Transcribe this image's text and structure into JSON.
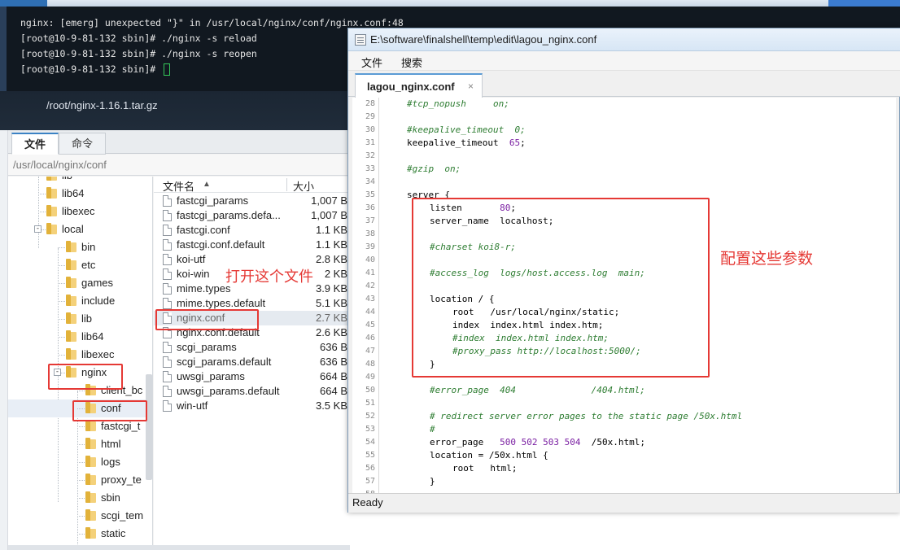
{
  "terminal": {
    "lines": [
      "nginx: [emerg] unexpected \"}\" in /usr/local/nginx/conf/nginx.conf:48",
      "[root@10-9-81-132 sbin]# ./nginx -s reload",
      "[root@10-9-81-132 sbin]# ./nginx -s reopen",
      "[root@10-9-81-132 sbin]# "
    ],
    "current_path": "/root/nginx-1.16.1.tar.gz"
  },
  "file_manager": {
    "tabs": [
      {
        "label": "文件",
        "active": true
      },
      {
        "label": "命令",
        "active": false
      }
    ],
    "path": "/usr/local/nginx/conf",
    "tree": [
      {
        "label": "lib",
        "selected": false
      },
      {
        "label": "lib64",
        "selected": false
      },
      {
        "label": "libexec",
        "selected": false
      },
      {
        "label": "local",
        "expander": "-",
        "selected": false
      },
      {
        "label": "bin",
        "selected": false
      },
      {
        "label": "etc",
        "selected": false
      },
      {
        "label": "games",
        "selected": false
      },
      {
        "label": "include",
        "selected": false
      },
      {
        "label": "lib",
        "selected": false
      },
      {
        "label": "lib64",
        "selected": false
      },
      {
        "label": "libexec",
        "selected": false
      },
      {
        "label": "nginx",
        "expander": "-",
        "selected": false
      },
      {
        "label": "client_bc",
        "selected": false
      },
      {
        "label": "conf",
        "selected": true
      },
      {
        "label": "fastcgi_t",
        "selected": false
      },
      {
        "label": "html",
        "selected": false
      },
      {
        "label": "logs",
        "selected": false
      },
      {
        "label": "proxy_te",
        "selected": false
      },
      {
        "label": "sbin",
        "selected": false
      },
      {
        "label": "scgi_tem",
        "selected": false
      },
      {
        "label": "static",
        "selected": false
      }
    ],
    "columns": {
      "name": "文件名",
      "size": "大小"
    },
    "files": [
      {
        "name": "fastcgi_params",
        "size": "1,007 B",
        "selected": false
      },
      {
        "name": "fastcgi_params.defa...",
        "size": "1,007 B",
        "selected": false
      },
      {
        "name": "fastcgi.conf",
        "size": "1.1 KB",
        "selected": false
      },
      {
        "name": "fastcgi.conf.default",
        "size": "1.1 KB",
        "selected": false
      },
      {
        "name": "koi-utf",
        "size": "2.8 KB",
        "selected": false
      },
      {
        "name": "koi-win",
        "size": "2 KB",
        "selected": false
      },
      {
        "name": "mime.types",
        "size": "3.9 KB",
        "selected": false
      },
      {
        "name": "mime.types.default",
        "size": "5.1 KB",
        "selected": false
      },
      {
        "name": "nginx.conf",
        "size": "2.7 KB",
        "selected": true
      },
      {
        "name": "nginx.conf.default",
        "size": "2.6 KB",
        "selected": false
      },
      {
        "name": "scgi_params",
        "size": "636 B",
        "selected": false
      },
      {
        "name": "scgi_params.default",
        "size": "636 B",
        "selected": false
      },
      {
        "name": "uwsgi_params",
        "size": "664 B",
        "selected": false
      },
      {
        "name": "uwsgi_params.default",
        "size": "664 B",
        "selected": false
      },
      {
        "name": "win-utf",
        "size": "3.5 KB",
        "selected": false
      }
    ]
  },
  "editor": {
    "title": "E:\\software\\finalshell\\temp\\edit\\lagou_nginx.conf",
    "menu": [
      "文件",
      "搜索"
    ],
    "tab_label": "lagou_nginx.conf",
    "tab_close": "×",
    "status": "Ready",
    "lines": [
      {
        "n": "28",
        "indent": 1,
        "comment": true,
        "code": "#tcp_nopush     on;"
      },
      {
        "n": "29",
        "indent": 0,
        "comment": false,
        "code": ""
      },
      {
        "n": "30",
        "indent": 1,
        "comment": true,
        "code": "#keepalive_timeout  0;"
      },
      {
        "n": "31",
        "indent": 1,
        "comment": false,
        "code": "keepalive_timeout  65;"
      },
      {
        "n": "32",
        "indent": 0,
        "comment": false,
        "code": ""
      },
      {
        "n": "33",
        "indent": 1,
        "comment": true,
        "code": "#gzip  on;"
      },
      {
        "n": "34",
        "indent": 0,
        "comment": false,
        "code": ""
      },
      {
        "n": "35",
        "indent": 1,
        "comment": false,
        "code": "server {"
      },
      {
        "n": "36",
        "indent": 2,
        "comment": false,
        "code": "listen       80;"
      },
      {
        "n": "37",
        "indent": 2,
        "comment": false,
        "code": "server_name  localhost;"
      },
      {
        "n": "38",
        "indent": 0,
        "comment": false,
        "code": ""
      },
      {
        "n": "39",
        "indent": 2,
        "comment": true,
        "code": "#charset koi8-r;"
      },
      {
        "n": "40",
        "indent": 0,
        "comment": false,
        "code": ""
      },
      {
        "n": "41",
        "indent": 2,
        "comment": true,
        "code": "#access_log  logs/host.access.log  main;"
      },
      {
        "n": "42",
        "indent": 0,
        "comment": false,
        "code": ""
      },
      {
        "n": "43",
        "indent": 2,
        "comment": false,
        "code": "location / {"
      },
      {
        "n": "44",
        "indent": 3,
        "comment": false,
        "code": "root   /usr/local/nginx/static;"
      },
      {
        "n": "45",
        "indent": 3,
        "comment": false,
        "code": "index  index.html index.htm;"
      },
      {
        "n": "46",
        "indent": 3,
        "comment": true,
        "code": "#index  index.html index.htm;"
      },
      {
        "n": "47",
        "indent": 3,
        "comment": true,
        "code": "#proxy_pass http://localhost:5000/;"
      },
      {
        "n": "48",
        "indent": 2,
        "comment": false,
        "code": "}"
      },
      {
        "n": "49",
        "indent": 0,
        "comment": false,
        "code": ""
      },
      {
        "n": "50",
        "indent": 2,
        "comment": true,
        "code": "#error_page  404              /404.html;"
      },
      {
        "n": "51",
        "indent": 0,
        "comment": false,
        "code": ""
      },
      {
        "n": "52",
        "indent": 2,
        "comment": true,
        "code": "# redirect server error pages to the static page /50x.html"
      },
      {
        "n": "53",
        "indent": 2,
        "comment": true,
        "code": "#"
      },
      {
        "n": "54",
        "indent": 2,
        "comment": false,
        "code": "error_page   500 502 503 504  /50x.html;"
      },
      {
        "n": "55",
        "indent": 2,
        "comment": false,
        "code": "location = /50x.html {"
      },
      {
        "n": "56",
        "indent": 3,
        "comment": false,
        "code": "root   html;"
      },
      {
        "n": "57",
        "indent": 2,
        "comment": false,
        "code": "}"
      },
      {
        "n": "58",
        "indent": 0,
        "comment": false,
        "code": ""
      }
    ]
  },
  "annotations": {
    "open_file": "打开这个文件",
    "configure": "配置这些参数",
    "color": "#e53935"
  },
  "colors": {
    "terminal_bg": "#111820",
    "comment": "#2e7d32",
    "number": "#7a1fa2",
    "accent": "#3b82c4"
  }
}
